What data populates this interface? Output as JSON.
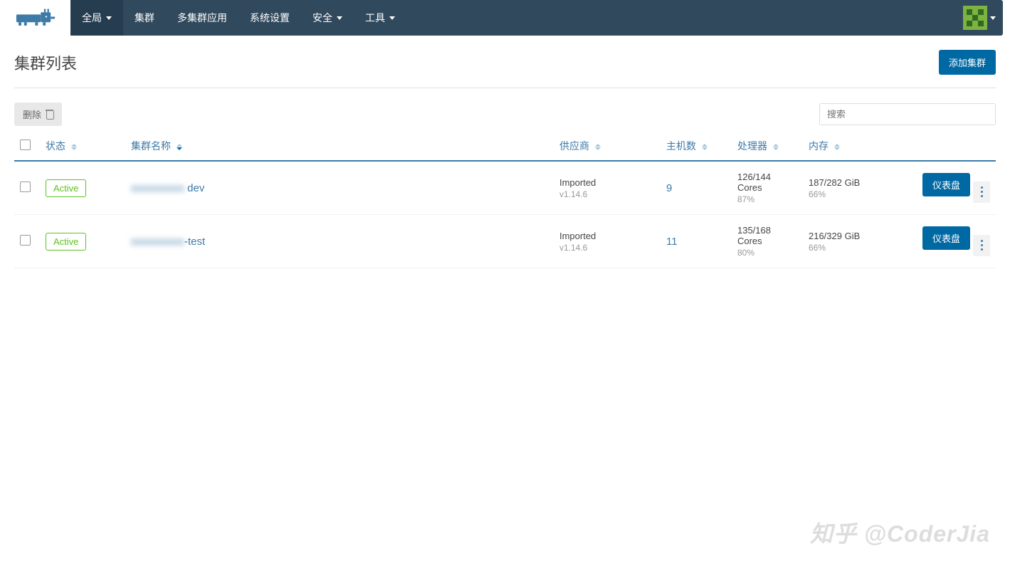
{
  "nav": {
    "global": "全局",
    "clusters": "集群",
    "multi_cluster": "多集群应用",
    "system_settings": "系统设置",
    "security": "安全",
    "tools": "工具"
  },
  "page": {
    "title": "集群列表",
    "add_button": "添加集群",
    "delete_button": "删除",
    "search_placeholder": "搜索"
  },
  "columns": {
    "state": "状态",
    "name": "集群名称",
    "provider": "供应商",
    "hosts": "主机数",
    "cpu": "处理器",
    "memory": "内存"
  },
  "row_actions": {
    "dashboard": "仪表盘"
  },
  "rows": [
    {
      "state": "Active",
      "name_blur": "xxxxxxxxxx",
      "name_suffix": " dev",
      "provider": "Imported",
      "version": "v1.14.6",
      "hosts": "9",
      "cpu": "126/144 Cores",
      "cpu_pct": "87%",
      "mem": "187/282 GiB",
      "mem_pct": "66%"
    },
    {
      "state": "Active",
      "name_blur": "xxxxxxxxxx",
      "name_suffix": "-test",
      "provider": "Imported",
      "version": "v1.14.6",
      "hosts": "11",
      "cpu": "135/168 Cores",
      "cpu_pct": "80%",
      "mem": "216/329 GiB",
      "mem_pct": "66%"
    }
  ],
  "watermark": "知乎 @CoderJia"
}
